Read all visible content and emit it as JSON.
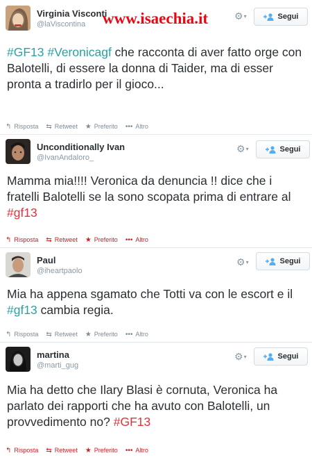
{
  "watermark": "www.isaechia.it",
  "colors": {
    "hashtag_teal": "#2ba1a1",
    "hashtag_red": "#e0323a",
    "muted": "#8899a6"
  },
  "follow_label": "Segui",
  "tweets": [
    {
      "name": "Virginia Visconti",
      "handle": "@laViscontina",
      "text_parts": [
        "#GF13",
        " ",
        "#Veronicagf",
        " che racconta di aver fatto orge con Balotelli, di essere la donna di Taider, ma di esser pronta a tradirlo per il gioco..."
      ],
      "actions": {
        "reply": "Risposta",
        "retweet": "Retweet",
        "favorite": "Preferito",
        "more": "Altro"
      }
    },
    {
      "name": "Unconditionally Ivan",
      "handle": "@IvanAndaloro_",
      "text_parts": [
        "Mamma mia!!!! Veronica da denuncia !! dice che i fratelli Balotelli se la sono scopata prima di entrare al ",
        "#gf13"
      ],
      "actions": {
        "reply": "Risposta",
        "retweet": "Retweet",
        "favorite": "Preferito",
        "more": "Altro"
      }
    },
    {
      "name": "Paul",
      "handle": "@iheartpaolo",
      "text_parts": [
        "Mia ha appena sgamato che Totti va con le escort e il ",
        "#gf13",
        " cambia regia."
      ],
      "actions": {
        "reply": "Risposta",
        "retweet": "Retweet",
        "favorite": "Preferito",
        "more": "Altro"
      }
    },
    {
      "name": "martina",
      "handle": "@marti_gug",
      "text_parts": [
        "Mia ha detto che Ilary Blasi è cornuta, Veronica ha parlato dei rapporti che ha avuto con Balotelli, un provvedimento no? ",
        "#GF13"
      ],
      "actions": {
        "reply": "Risposta",
        "retweet": "Retweet",
        "favorite": "Preferito",
        "more": "Altro"
      }
    }
  ]
}
